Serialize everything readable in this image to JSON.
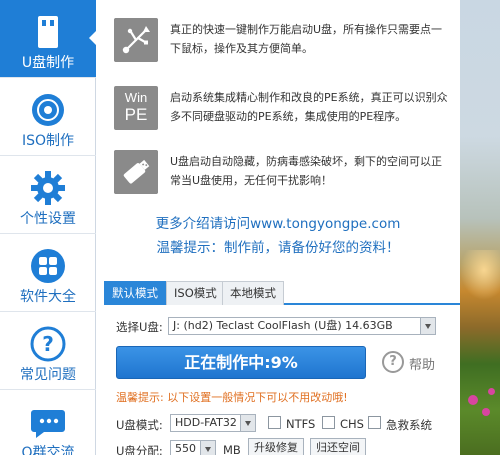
{
  "sidebar": {
    "items": [
      {
        "label": "U盘制作",
        "icon": "usb-drive-icon",
        "active": true
      },
      {
        "label": "ISO制作",
        "icon": "disc-icon",
        "active": false
      },
      {
        "label": "个性设置",
        "icon": "gear-icon",
        "active": false
      },
      {
        "label": "软件大全",
        "icon": "apps-grid-icon",
        "active": false
      },
      {
        "label": "常见问题",
        "icon": "question-icon",
        "active": false
      },
      {
        "label": "Q群交流",
        "icon": "chat-bubble-icon",
        "active": false
      }
    ]
  },
  "features": [
    {
      "icon": "usb-symbol-icon",
      "text": "真正的快速一键制作万能启动U盘，所有操作只需要点一下鼠标，操作及其方便简单。"
    },
    {
      "icon": "winpe-icon",
      "icon_text_1": "Win",
      "icon_text_2": "PE",
      "text": "启动系统集成精心制作和改良的PE系统，真正可以识别众多不同硬盘驱动的PE系统，集成使用的PE程序。"
    },
    {
      "icon": "usb-stick-icon",
      "text": "U盘启动自动隐藏，防病毒感染破坏，剩下的空间可以正常当U盘使用，无任何干扰影响！"
    }
  ],
  "links": {
    "more_info": "更多介绍请访问www.tongyongpe.com",
    "reminder": "温馨提示：制作前，请备份好您的资料！"
  },
  "tabs": [
    {
      "label": "默认模式",
      "active": true
    },
    {
      "label": "ISO模式",
      "active": false
    },
    {
      "label": "本地模式",
      "active": false
    }
  ],
  "select_disk": {
    "label": "选择U盘:",
    "value": "J: (hd2) Teclast CoolFlash  (U盘) 14.63GB"
  },
  "progress": {
    "label": "正在制作中:9%",
    "percent": 9
  },
  "help": {
    "label": "帮助"
  },
  "tip": "温馨提示: 以下设置一般情况下可以不用改动哦!",
  "mode": {
    "label": "U盘模式:",
    "value": "HDD-FAT32",
    "options": [
      {
        "label": "NTFS",
        "checked": false
      },
      {
        "label": "CHS",
        "checked": false
      },
      {
        "label": "急救系统",
        "checked": false
      }
    ]
  },
  "partition": {
    "label": "U盘分配:",
    "value": "550",
    "unit": "MB",
    "upgrade_label": "升级修复",
    "restore_label": "归还空间"
  },
  "colors": {
    "accent": "#1f7ed6",
    "progress": "#2a86d8",
    "tip": "#e07022",
    "link": "#1f6fbf"
  }
}
